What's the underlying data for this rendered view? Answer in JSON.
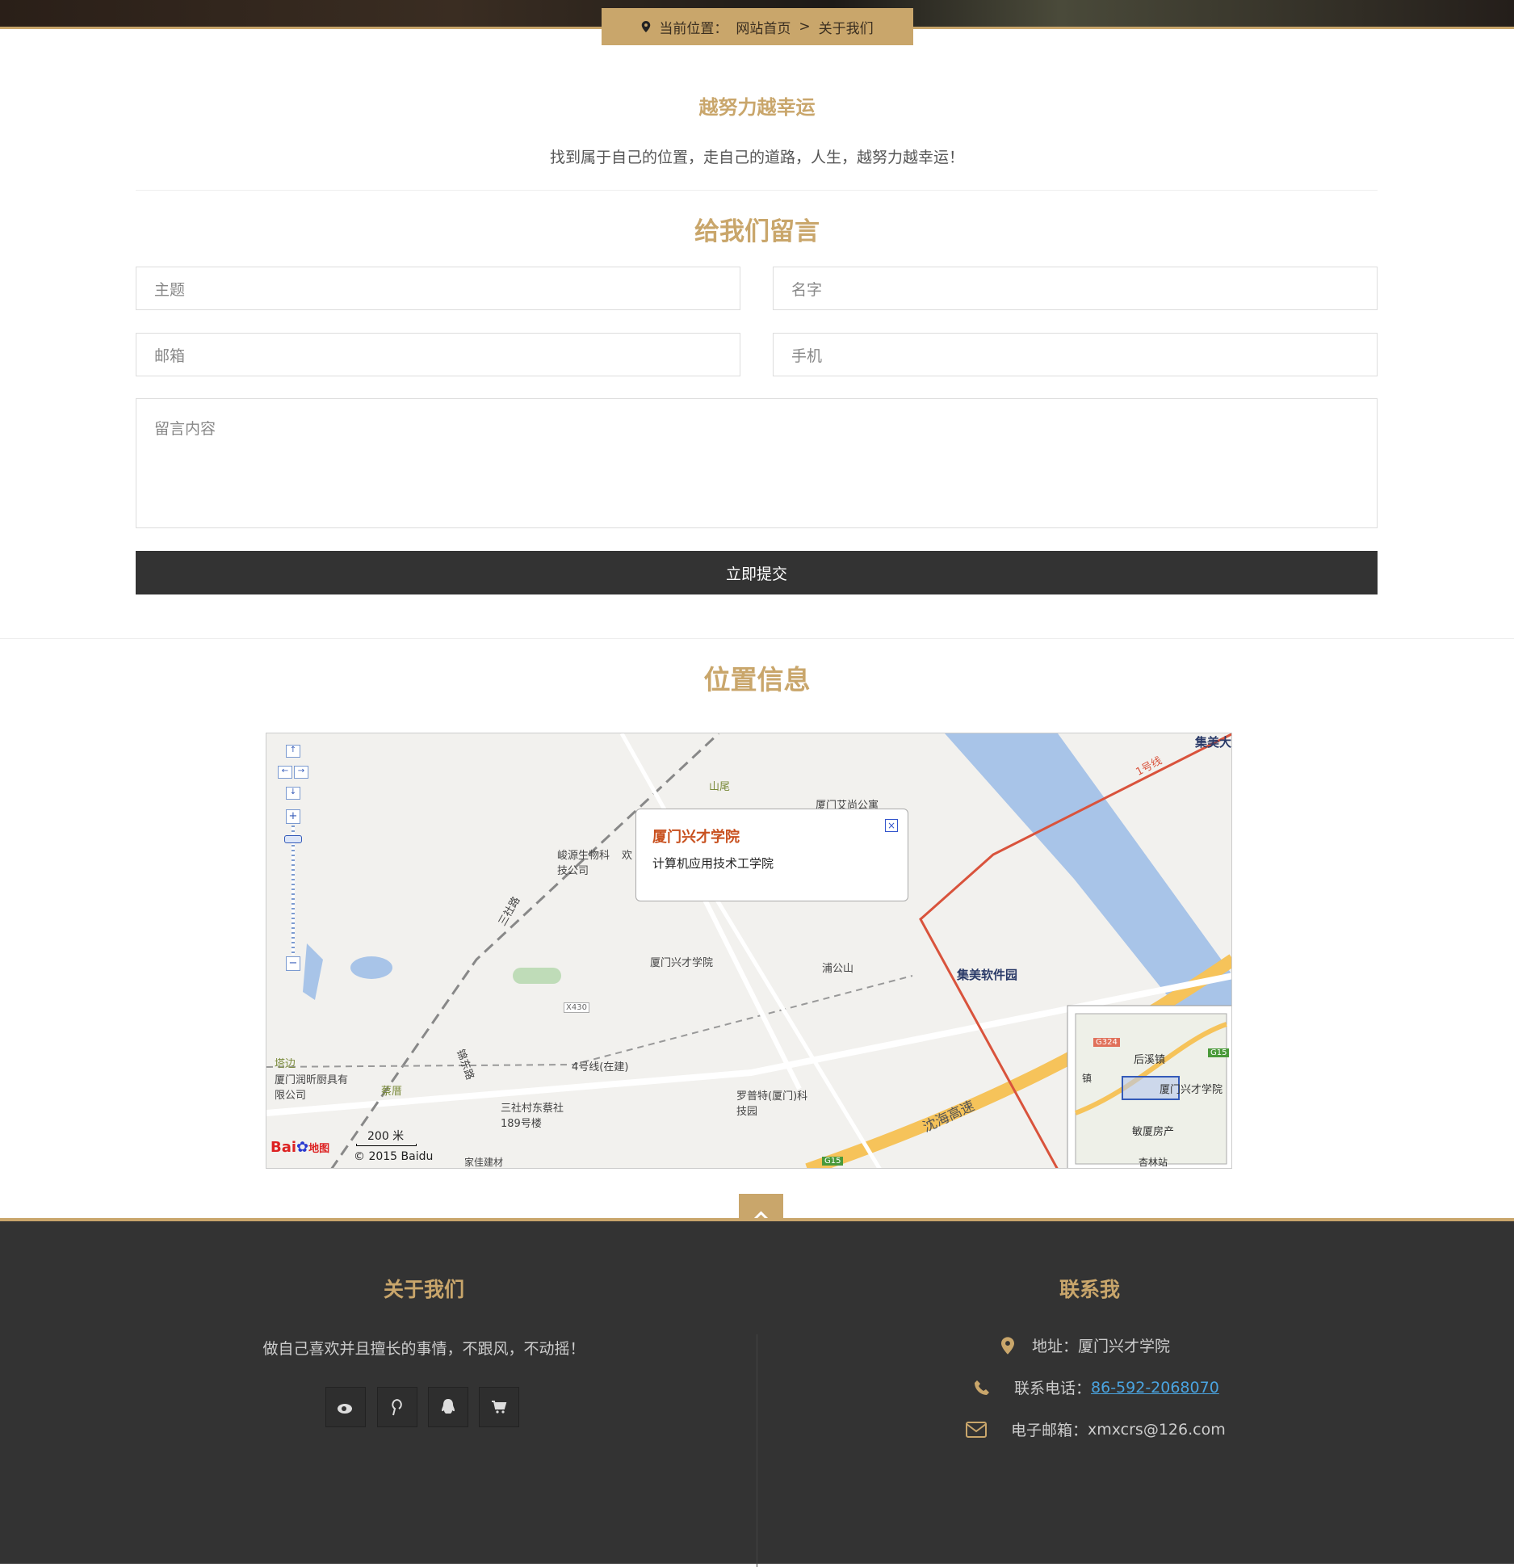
{
  "breadcrumb": {
    "label": "当前位置：",
    "home": "网站首页",
    "sep": ">",
    "current": "关于我们"
  },
  "intro": {
    "title": "越努力越幸运",
    "slogan": "找到属于自己的位置，走自己的道路，人生，越努力越幸运！"
  },
  "form": {
    "title": "给我们留言",
    "subject_placeholder": "主题",
    "name_placeholder": "名字",
    "email_placeholder": "邮箱",
    "phone_placeholder": "手机",
    "message_placeholder": "留言内容",
    "submit_label": "立即提交"
  },
  "location": {
    "title": "位置信息",
    "popup_title": "厦门兴才学院",
    "popup_subtitle": "计算机应用技术工学院",
    "labels": [
      "厦门兴才学院",
      "集美软件园",
      "浦公山",
      "沈海高速",
      "4号线(在建)",
      "三社村东蔡社189号楼",
      "罗普特(厦门)科技园",
      "峻源生物科技公司",
      "厦门润昕厨具有限公司",
      "塔边",
      "蔡厝",
      "山尾",
      "厦门艾尚公寓",
      "锦东路",
      "三社路",
      "集美大",
      "家佳建材",
      "X430",
      "G15",
      "1号线",
      "欢"
    ],
    "inset_labels": [
      "G324",
      "后溪镇",
      "厦门兴才学院",
      "敏厦房产",
      "G15",
      "杏林站",
      "镇"
    ],
    "scale": "200 米",
    "copyright": "© 2015 Baidu",
    "logo_text": "Bai",
    "logo_suffix": "地图"
  },
  "footer": {
    "about_title": "关于我们",
    "about_desc": "做自己喜欢并且擅长的事情，不跟风，不动摇！",
    "social_icons": [
      "weibo-icon",
      "pinterest-icon",
      "qq-icon",
      "cart-icon"
    ],
    "contact_title": "联系我",
    "address_label": "地址：",
    "address_value": "厦门兴才学院",
    "phone_label": "联系电话：",
    "phone_value": "86-592-2068070",
    "email_label": "电子邮箱：",
    "email_value": "xmxcrs@126.com"
  },
  "colors": {
    "accent": "#c9a66b",
    "dark": "#333333",
    "link": "#4aa3df",
    "popup_title": "#c8501e"
  }
}
